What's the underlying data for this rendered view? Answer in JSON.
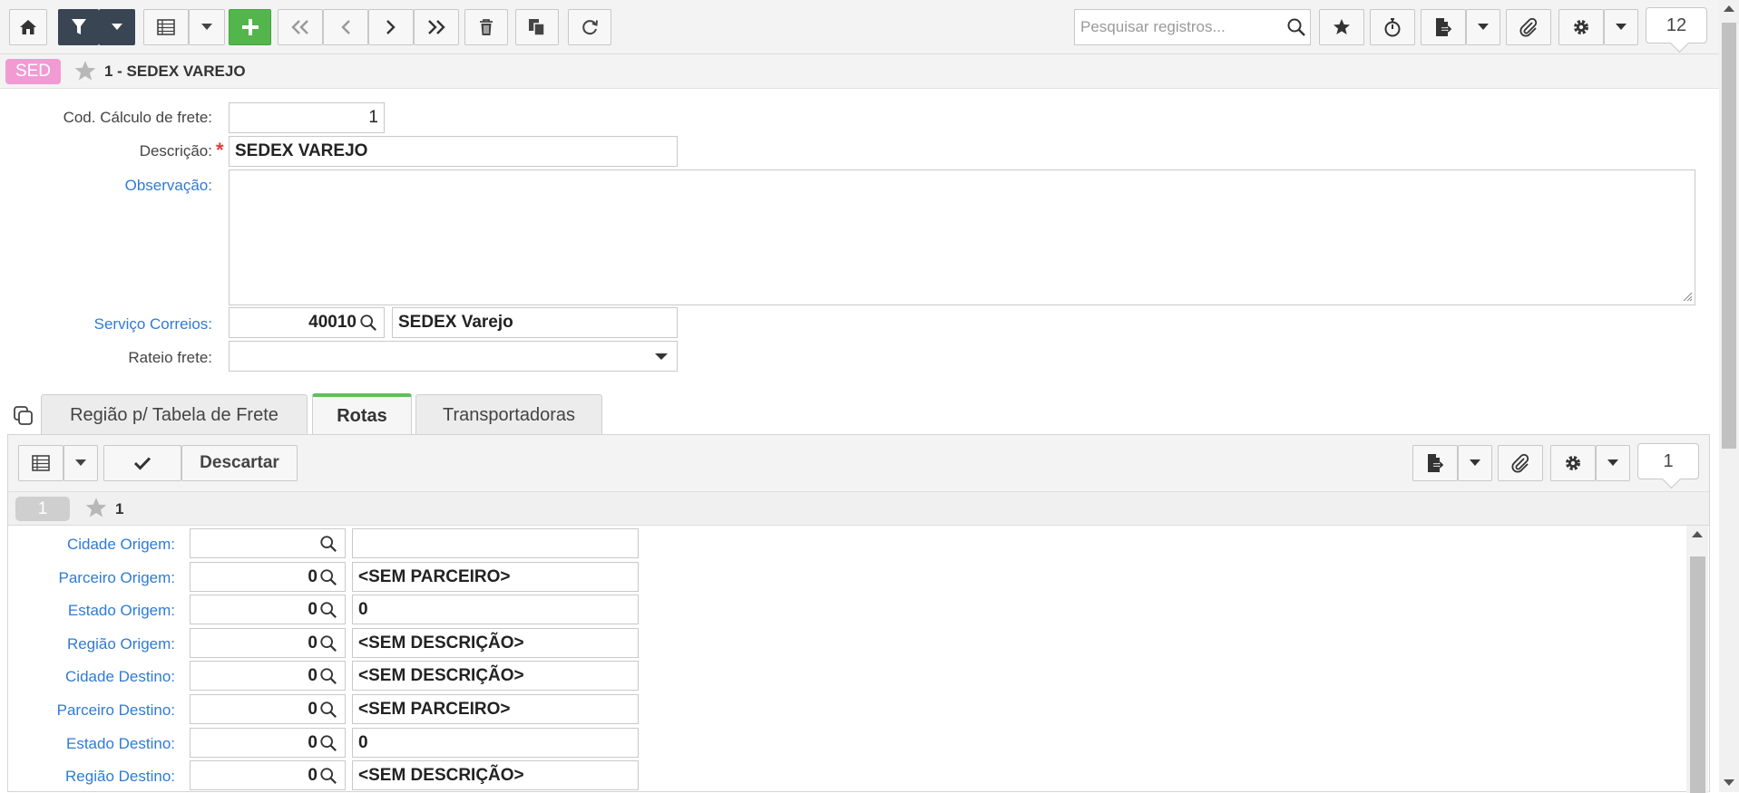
{
  "toolbar": {
    "search_placeholder": "Pesquisar registros...",
    "page_size": "12"
  },
  "record": {
    "badge": "SED",
    "title": "1 - SEDEX VAREJO"
  },
  "form": {
    "cod_label": "Cod. Cálculo de frete:",
    "cod_value": "1",
    "descricao_label": "Descrição:",
    "descricao_value": "SEDEX VAREJO",
    "observacao_label": "Observação:",
    "observacao_value": "",
    "servico_label": "Serviço Correios:",
    "servico_code": "40010",
    "servico_desc": "SEDEX Varejo",
    "rateio_label": "Rateio frete:",
    "rateio_value": ""
  },
  "tabs": [
    {
      "label": "Região p/ Tabela de Frete"
    },
    {
      "label": "Rotas"
    },
    {
      "label": "Transportadoras"
    }
  ],
  "sub": {
    "discard_label": "Descartar",
    "page_size": "1",
    "record_badge": "1",
    "record_title": "1",
    "rows": [
      {
        "label": "Cidade Origem:",
        "code": "",
        "desc": ""
      },
      {
        "label": "Parceiro Origem:",
        "code": "0",
        "desc": "<SEM PARCEIRO>"
      },
      {
        "label": "Estado Origem:",
        "code": "0",
        "desc": "0"
      },
      {
        "label": "Região Origem:",
        "code": "0",
        "desc": "<SEM DESCRIÇÃO>"
      },
      {
        "label": "Cidade Destino:",
        "code": "0",
        "desc": "<SEM DESCRIÇÃO>"
      },
      {
        "label": "Parceiro Destino:",
        "code": "0",
        "desc": "<SEM PARCEIRO>"
      },
      {
        "label": "Estado Destino:",
        "code": "0",
        "desc": "0"
      },
      {
        "label": "Região Destino:",
        "code": "0",
        "desc": "<SEM DESCRIÇÃO>"
      }
    ]
  }
}
